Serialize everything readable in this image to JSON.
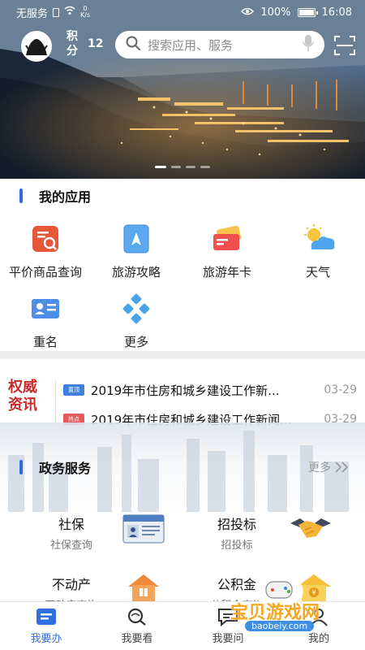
{
  "status_bar": {
    "carrier": "无服务",
    "net_speed_value": "0",
    "net_speed_unit": "K/s",
    "battery": "100%",
    "time": "16:08"
  },
  "header": {
    "points_label": "积分",
    "points_value": "12",
    "search_placeholder": "搜索应用、服务"
  },
  "banner": {
    "slide_count": 4,
    "active_slide": 1
  },
  "my_apps": {
    "title": "我的应用",
    "items": [
      {
        "label": "平价商品查询",
        "icon": "price-query-icon"
      },
      {
        "label": "旅游攻略",
        "icon": "compass-guide-icon"
      },
      {
        "label": "旅游年卡",
        "icon": "travel-card-icon"
      },
      {
        "label": "天气",
        "icon": "weather-icon"
      },
      {
        "label": "重名",
        "icon": "id-card-icon"
      },
      {
        "label": "更多",
        "icon": "more-apps-icon"
      }
    ]
  },
  "news": {
    "logo_line1": "权威",
    "logo_line2": "资讯",
    "items": [
      {
        "tag": "置顶",
        "tag_color": "#3f7fe0",
        "title": "2019年市住房和城乡建设工作新...",
        "date": "03-29"
      },
      {
        "tag": "热点",
        "tag_color": "#e25a5a",
        "title": "2019年市住房和城乡建设工作新闻...",
        "date": "03-29"
      }
    ]
  },
  "gov_services": {
    "title": "政务服务",
    "more_label": "更多",
    "items": [
      {
        "title": "社保",
        "subtitle": "社保查询",
        "icon": "social-security-card-icon"
      },
      {
        "title": "招投标",
        "subtitle": "招投标",
        "icon": "handshake-icon"
      },
      {
        "title": "不动产",
        "subtitle": "不动产查询",
        "icon": "house-icon"
      },
      {
        "title": "公积金",
        "subtitle": "公积金查询",
        "icon": "fund-house-icon"
      }
    ]
  },
  "tabbar": {
    "items": [
      {
        "label": "我要办",
        "active": true
      },
      {
        "label": "我要看",
        "active": false
      },
      {
        "label": "我要问",
        "active": false
      },
      {
        "label": "我的",
        "active": false
      }
    ]
  },
  "watermark": {
    "text": "宝贝游戏网",
    "url": "baobeiy.com"
  },
  "colors": {
    "accent": "#2f6fdd",
    "news_logo": "#c62b2b",
    "search_bg": "#ffffff"
  }
}
